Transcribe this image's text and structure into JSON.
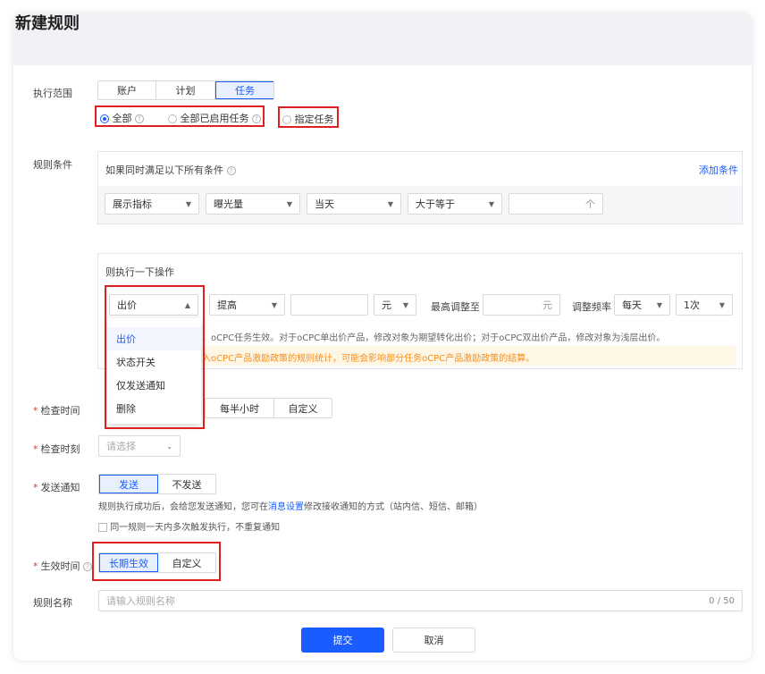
{
  "title": "新建规则",
  "scope": {
    "label": "执行范围",
    "tabs": [
      "账户",
      "计划",
      "任务"
    ],
    "active_tab": "任务",
    "radios": [
      "全部",
      "全部已启用任务",
      "指定任务"
    ],
    "selected_radio": "全部"
  },
  "conditions": {
    "label": "规则条件",
    "header": "如果同时满足以下所有条件",
    "add_link": "添加条件",
    "selects": [
      "展示指标",
      "曝光量",
      "当天",
      "大于等于"
    ],
    "unit": "个"
  },
  "actions": {
    "header": "则执行一下操作",
    "action_select": "出价",
    "change_select": "提高",
    "unit_select": "元",
    "max_label": "最高调整至",
    "max_unit": "元",
    "freq_label": "调整频率",
    "freq_select": "每天",
    "times_select": "1次",
    "info_text": "、oCPC任务生效。对于oCPC单出价产品，修改对象为期望转化出价；对于oCPC双出价产品，修改对象为浅层出价。",
    "warning_text": "入oCPC产品激励政策的规则统计，可能会影响部分任务oCPC产品激励政策的结算。",
    "dropdown_options": [
      "出价",
      "状态开关",
      "仅发送通知",
      "删除"
    ]
  },
  "check_time": {
    "label": "检查时间",
    "options": [
      "每半小时",
      "自定义"
    ]
  },
  "check_moment": {
    "label": "检查时刻",
    "placeholder": "请选择"
  },
  "notify": {
    "label": "发送通知",
    "options": [
      "发送",
      "不发送"
    ],
    "active": "发送",
    "desc_pre": "规则执行成功后，会给您发送通知，您可在",
    "desc_link": "消息设置",
    "desc_post": "修改接收通知的方式（站内信、短信、邮箱）",
    "checkbox_label": "同一规则一天内多次触发执行，不重复通知"
  },
  "effective": {
    "label": "生效时间",
    "options": [
      "长期生效",
      "自定义"
    ],
    "active": "长期生效"
  },
  "rule_name": {
    "label": "规则名称",
    "placeholder": "请输入规则名称",
    "counter": "0 / 50"
  },
  "footer": {
    "submit": "提交",
    "cancel": "取消"
  },
  "colors": {
    "primary": "#1a5cff",
    "annotation": "#e02020",
    "warning_bg": "#fff7e6",
    "warning_text": "#fa8c16"
  }
}
